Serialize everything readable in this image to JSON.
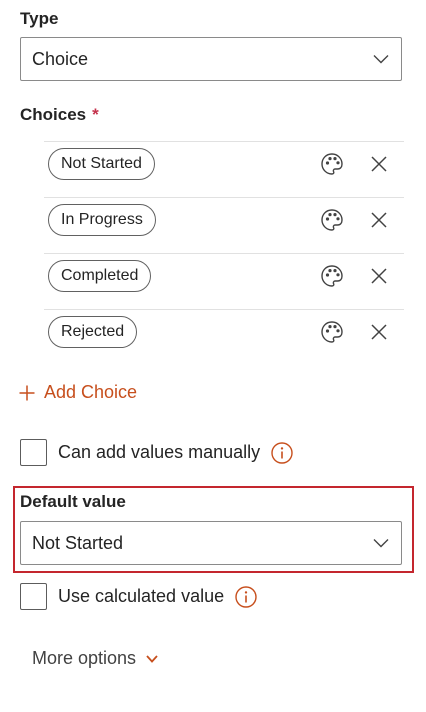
{
  "type_section": {
    "label": "Type",
    "selected": "Choice"
  },
  "choices_section": {
    "label": "Choices",
    "required_marker": "*",
    "items": [
      {
        "label": "Not Started"
      },
      {
        "label": "In Progress"
      },
      {
        "label": "Completed"
      },
      {
        "label": "Rejected"
      }
    ],
    "add_label": "Add Choice"
  },
  "manual_values": {
    "label": "Can add values manually",
    "checked": false
  },
  "default_value": {
    "label": "Default value",
    "selected": "Not Started"
  },
  "calculated_value": {
    "label": "Use calculated value",
    "checked": false
  },
  "more_options": {
    "label": "More options"
  },
  "colors": {
    "accent": "#c74f1d",
    "highlight_border": "#c4262e",
    "required": "#c4314b"
  },
  "icons": {
    "dropdown": "chevron-down-icon",
    "palette": "palette-icon",
    "remove": "close-icon",
    "add": "plus-icon",
    "info": "info-icon"
  }
}
